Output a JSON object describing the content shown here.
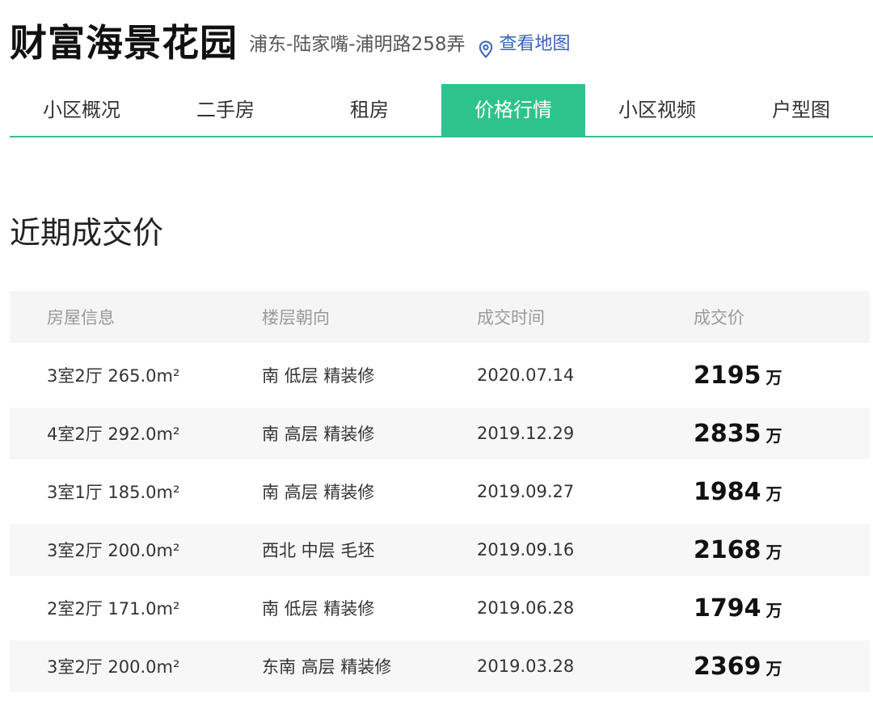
{
  "header": {
    "title": "财富海景花园",
    "address": "浦东-陆家嘴-浦明路258弄",
    "map_link": "查看地图",
    "map_icon": "location-pin-icon",
    "link_color": "#3a63b8"
  },
  "tabs": [
    {
      "label": "小区概况",
      "active": false
    },
    {
      "label": "二手房",
      "active": false
    },
    {
      "label": "租房",
      "active": false
    },
    {
      "label": "价格行情",
      "active": true
    },
    {
      "label": "小区视频",
      "active": false
    },
    {
      "label": "户型图",
      "active": false
    }
  ],
  "accent_color": "#2ec38d",
  "section": {
    "title": "近期成交价"
  },
  "table": {
    "columns": [
      "房屋信息",
      "楼层朝向",
      "成交时间",
      "成交价"
    ],
    "price_unit": "万",
    "rows": [
      {
        "info": "3室2厅 265.0m²",
        "floor": "南 低层 精装修",
        "date": "2020.07.14",
        "price": "2195"
      },
      {
        "info": "4室2厅 292.0m²",
        "floor": "南 高层 精装修",
        "date": "2019.12.29",
        "price": "2835"
      },
      {
        "info": "3室1厅 185.0m²",
        "floor": "南 高层 精装修",
        "date": "2019.09.27",
        "price": "1984"
      },
      {
        "info": "3室2厅 200.0m²",
        "floor": "西北 中层 毛坯",
        "date": "2019.09.16",
        "price": "2168"
      },
      {
        "info": "2室2厅 171.0m²",
        "floor": "南 低层 精装修",
        "date": "2019.06.28",
        "price": "1794"
      },
      {
        "info": "3室2厅 200.0m²",
        "floor": "东南 高层 精装修",
        "date": "2019.03.28",
        "price": "2369"
      }
    ]
  }
}
